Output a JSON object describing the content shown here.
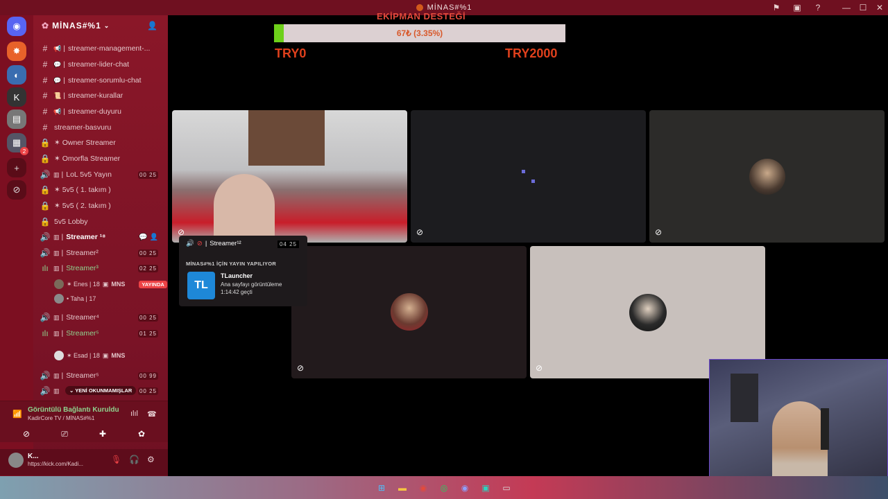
{
  "window": {
    "title": "MİNAS#%1"
  },
  "server": {
    "name": "MİNAS#%1"
  },
  "channels": [
    {
      "type": "text",
      "emoji": "📢",
      "name": "streamer-management-..."
    },
    {
      "type": "text",
      "emoji": "💬",
      "name": "streamer-lider-chat"
    },
    {
      "type": "text",
      "emoji": "💬",
      "name": "streamer-sorumlu-chat"
    },
    {
      "type": "text",
      "emoji": "📜",
      "name": "streamer-kurallar"
    },
    {
      "type": "text",
      "emoji": "📢",
      "name": "streamer-duyuru"
    },
    {
      "type": "text",
      "emoji": "",
      "name": "streamer-basvuru"
    },
    {
      "type": "locked",
      "name": "✶ Owner Streamer"
    },
    {
      "type": "locked",
      "name": "✶ Omorfla Streamer"
    },
    {
      "type": "voice",
      "name": "LoL 5v5 Yayın",
      "count": "00 25"
    },
    {
      "type": "locked",
      "name": "✶ 5v5 ( 1. takım )"
    },
    {
      "type": "locked",
      "name": "✶ 5v5 ( 2. takım )"
    },
    {
      "type": "locked",
      "name": "5v5 Lobby"
    },
    {
      "type": "voice",
      "name": "Streamer ¹⁸",
      "active": true
    },
    {
      "type": "voice",
      "name": "Streamer²",
      "count": "00 25"
    },
    {
      "type": "voice",
      "name": "Streamer³",
      "count": "02 25",
      "green": true
    },
    {
      "type": "voice",
      "name": "Streamer⁴",
      "count": "00 25"
    },
    {
      "type": "voice",
      "name": "Streamer⁵",
      "count": "01 25",
      "green": true
    },
    {
      "type": "voice",
      "name": "Streamer⁵",
      "count": "00 99"
    },
    {
      "type": "voice",
      "name": "",
      "count": "00 25"
    }
  ],
  "members": {
    "enes": "✶ Enes | 18",
    "enes_tag": "MNS",
    "live": "YAYINDA",
    "taha": "• Taha | 17",
    "esad": "✶ Esad | 18",
    "esad_tag": "MNS"
  },
  "unread_label": "YENİ OKUNMAMIŞLAR",
  "voice_panel": {
    "status": "Görüntülü Bağlantı Kuruldu",
    "sub": "KadirCore TV / MİNAS#%1"
  },
  "user_panel": {
    "name": "K...",
    "status": "https://kick.com/Kadi..."
  },
  "donation": {
    "title": "EKİPMAN DESTEĞİ",
    "progress_text": "67₺ (3.35%)",
    "progress_fraction": 0.0335,
    "min_label": "TRY0",
    "max_label": "TRY2000",
    "fill_color": "#6ed01a"
  },
  "popup": {
    "channel": "Streamer¹²",
    "count": "04 25",
    "stream_label": "MİNAS#%1 İÇİN YAYIN YAPILIYOR",
    "app_icon": "TL",
    "app_name": "TLauncher",
    "activity": "Ana sayfayı görüntüleme",
    "elapsed": "1:14:42 geçti"
  },
  "colors": {
    "accent": "#7c0f21",
    "voice_green": "#8fd48f",
    "live_red": "#ed4245"
  }
}
